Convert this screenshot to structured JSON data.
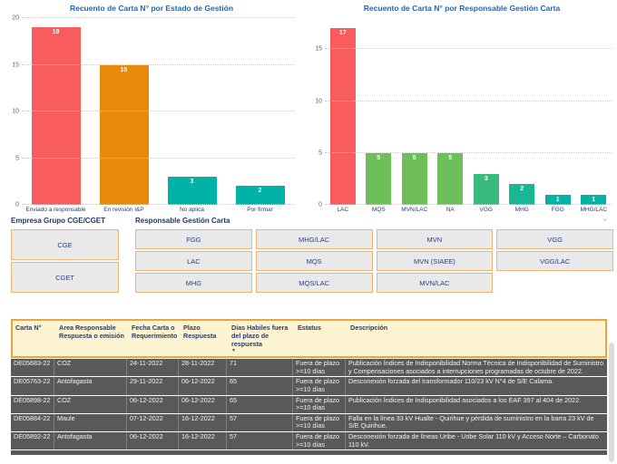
{
  "icons": {
    "chevron_down": "⌄"
  },
  "chart_data": [
    {
      "type": "bar",
      "title": "Recuento de Carta  N° por Estado de Gestión",
      "categories": [
        "Enviado a responsable",
        "En revisión I&P",
        "No aplica",
        "Por firmar"
      ],
      "values": [
        19,
        15,
        3,
        2
      ],
      "colors": [
        "#f85c5c",
        "#e8890c",
        "#00b3a6",
        "#00b3a6"
      ],
      "yticks": [
        0,
        5,
        10,
        15,
        20
      ],
      "ylim": [
        0,
        20
      ],
      "grid": "dotted horizontal",
      "legend": "none"
    },
    {
      "type": "bar",
      "title": "Recuento de Carta  N° por Responsable Gestión Carta",
      "categories": [
        "LAC",
        "MQS",
        "MVN/LAC",
        "NA",
        "VGG",
        "MHG",
        "FGG",
        "MHG/LAC"
      ],
      "values": [
        17,
        5,
        5,
        5,
        3,
        2,
        1,
        1
      ],
      "colors": [
        "#f85c5c",
        "#6ebf59",
        "#6ebf59",
        "#6ebf59",
        "#38ba7d",
        "#19b793",
        "#00b3a6",
        "#00b3a6"
      ],
      "yticks": [
        0,
        5,
        10,
        15
      ],
      "ylim": [
        0,
        18
      ],
      "grid": "dotted horizontal",
      "legend": "none"
    }
  ],
  "filters": {
    "empresa": {
      "label": "Empresa Grupo CGE/CGET",
      "options": [
        "CGE",
        "CGET"
      ]
    },
    "responsable": {
      "label": "Responsable Gestión Carta",
      "options": [
        "FGG",
        "MHG/LAC",
        "MVN",
        "VGG",
        "LAC",
        "MQS",
        "MVN (SIAEE)",
        "VGG/LAC",
        "MHG",
        "MQS/LAC",
        "MVN/LAC"
      ]
    }
  },
  "table": {
    "headers": [
      "Carta N°",
      "Area Responsable Respuesta o emisión",
      "Fecha Carta o Requerimiento",
      "Plazo Respuesta",
      "Días Habiles fuera del plazo de respuesta",
      "Estatus",
      "Descripción"
    ],
    "sort_column_index": 4,
    "sort_direction": "desc",
    "rows": [
      [
        "DE05683-22",
        "COZ",
        "24-11-2022",
        "28-11-2022",
        "71",
        "Fuera de plazo\n>=10 días",
        "Publicación Índices de Indisponibilidad Norma Técnica de Indisponibilidad de Suministro y Compensaciones asociados a interrupciones programadas de octubre de 2022."
      ],
      [
        "DE05763-22",
        "Antofagasta",
        "29-11-2022",
        "06-12-2022",
        "65",
        "Fuera de plazo\n>=10 días",
        "Desconexión forzada del transformador 110/23 kV N°4 de S/E Calama."
      ],
      [
        "DE05898-22",
        "COZ",
        "06-12-2022",
        "06-12-2022",
        "65",
        "Fuera de plazo\n>=10 días",
        "Publicación Índices de Indisponibilidad asociados a los EAF 397 al 404 de 2022."
      ],
      [
        "DE05884-22",
        "Maule",
        "07-12-2022",
        "16-12-2022",
        "57",
        "Fuera de plazo\n>=10 días",
        "Falla en la línea 33 kV Hualte - Quirihue y pérdida de suministro en la barra 23 kV de S/E Quirihue."
      ],
      [
        "DE05892-22",
        "Antofagasta",
        "06-12-2022",
        "16-12-2022",
        "57",
        "Fuera de plazo\n>=10 días",
        "Desconexión forzada de líneas Uribe - Uribe Solar 110 kV y Acceso Norte – Carbonato 110 kV."
      ]
    ]
  },
  "colors": {
    "title_blue": "#1a67b7",
    "bar_red": "#f85c5c",
    "bar_orange": "#e8890c",
    "bar_teal": "#00b3a6",
    "bar_green": "#6ebf59",
    "header_bg": "#fcf3d1",
    "header_border": "#efa13b",
    "row_bg": "#595959",
    "button_border": "#f0b274"
  }
}
